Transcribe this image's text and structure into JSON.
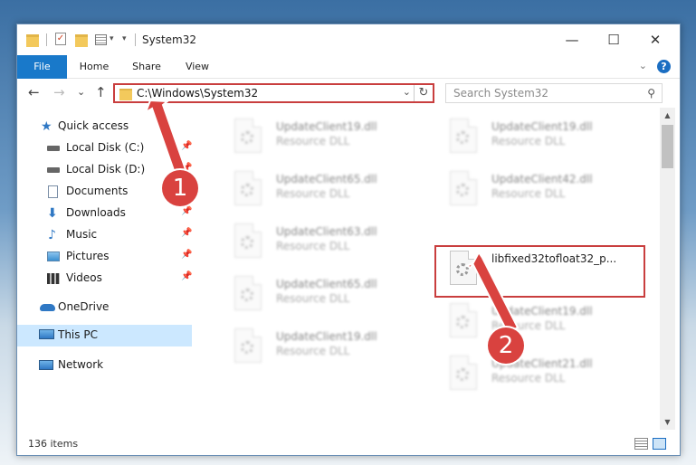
{
  "window": {
    "title": "System32",
    "controls": {
      "minimize": "—",
      "maximize": "☐",
      "close": "✕"
    }
  },
  "ribbon": {
    "tabs": [
      "File",
      "Home",
      "Share",
      "View"
    ],
    "expand_icon": "⌄",
    "help_icon": "?"
  },
  "address": {
    "path": "C:\\Windows\\System32",
    "back": "←",
    "forward": "→",
    "recent": "⌄",
    "up": "↑",
    "dropdown": "⌄",
    "refresh": "↻"
  },
  "search": {
    "placeholder": "Search System32",
    "icon": "⚲"
  },
  "nav": {
    "pin_glyph": "📌",
    "items": [
      {
        "label": "Quick access",
        "icon": "star-icon",
        "color": "#2f78c4"
      },
      {
        "label": "Local Disk (C:)",
        "icon": "drive-icon",
        "color": "#555555"
      },
      {
        "label": "Local Disk (D:)",
        "icon": "drive-icon",
        "color": "#555555"
      },
      {
        "label": "Documents",
        "icon": "documents-icon",
        "color": "#7a8ea6"
      },
      {
        "label": "Downloads",
        "icon": "downloads-icon",
        "color": "#2f78c4"
      },
      {
        "label": "Music",
        "icon": "music-icon",
        "color": "#2f78c4"
      },
      {
        "label": "Pictures",
        "icon": "pictures-icon",
        "color": "#3a8fd1"
      },
      {
        "label": "Videos",
        "icon": "videos-icon",
        "color": "#333333"
      },
      {
        "label": "OneDrive",
        "icon": "cloud-icon",
        "color": "#2f78c4"
      },
      {
        "label": "This PC",
        "icon": "computer-icon",
        "color": "#2f78c4"
      },
      {
        "label": "Network",
        "icon": "network-icon",
        "color": "#2f78c4"
      }
    ]
  },
  "files": [
    {
      "name": "UpdateClient19.dll",
      "type": "Resource DLL"
    },
    {
      "name": "UpdateClient19.dll",
      "type": "Resource DLL"
    },
    {
      "name": "UpdateClient65.dll",
      "type": "Resource DLL"
    },
    {
      "name": "UpdateClient42.dll",
      "type": "Resource DLL"
    },
    {
      "name": "UpdateClient63.dll",
      "type": "Resource DLL"
    },
    {
      "name": "libfixed32tofloat32_p...",
      "type": ""
    },
    {
      "name": "UpdateClient65.dll",
      "type": "Resource DLL"
    },
    {
      "name": "UpdateClient19.dll",
      "type": "Resource DLL"
    },
    {
      "name": "UpdateClient19.dll",
      "type": "Resource DLL"
    },
    {
      "name": "UpdateClient21.dll",
      "type": "Resource DLL"
    }
  ],
  "status": {
    "count": "136 items"
  },
  "callouts": [
    "1",
    "2"
  ],
  "colors": {
    "accent": "#1979ca",
    "highlight": "#c93e3e",
    "selected": "#cce8ff"
  }
}
